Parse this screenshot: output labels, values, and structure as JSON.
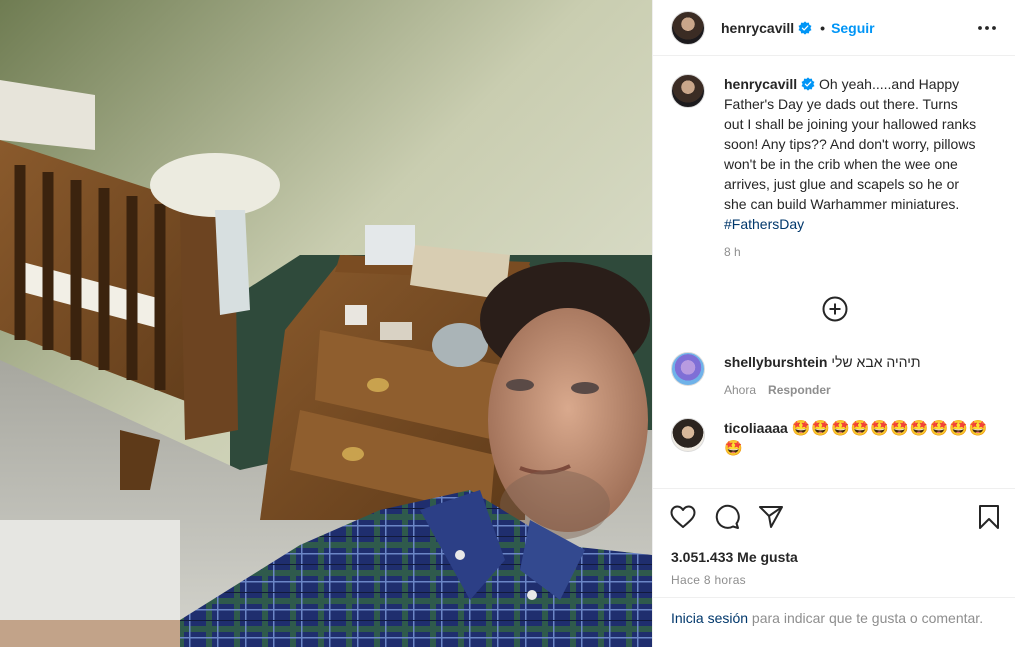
{
  "colors": {
    "accent": "#0095f6",
    "hashtag": "#00376b",
    "text": "#262626",
    "muted": "#8e8e8e",
    "border": "#efefef"
  },
  "header": {
    "username": "henrycavill",
    "separator": "•",
    "follow_label": "Seguir",
    "more_icon": "more-horizontal-icon"
  },
  "caption": {
    "username": "henrycavill",
    "text": "Oh yeah.....and Happy Father's Day ye dads out there. Turns out I shall be joining your hallowed ranks soon! Any tips?? And don't worry, pillows won't be in the crib when the wee one arrives, just glue and scapels so he or she can build Warhammer miniatures.",
    "hashtag": "#FathersDay",
    "time": "8 h"
  },
  "load_more_icon": "plus-circle-icon",
  "comments": [
    {
      "username": "shellyburshtein",
      "text": "תיהיה אבא שלי",
      "time": "Ahora",
      "reply_label": "Responder"
    },
    {
      "username": "ticoliaaaa",
      "text": "🤩🤩🤩🤩🤩🤩🤩🤩🤩🤩🤩"
    }
  ],
  "actions": {
    "icons": [
      "heart-icon",
      "comment-icon",
      "share-icon",
      "bookmark-icon"
    ]
  },
  "likes_text": "3.051.433 Me gusta",
  "time_ago": "Hace 8 horas",
  "login": {
    "link": "Inicia sesión",
    "rest": " para indicar que te gusta o comentar."
  }
}
